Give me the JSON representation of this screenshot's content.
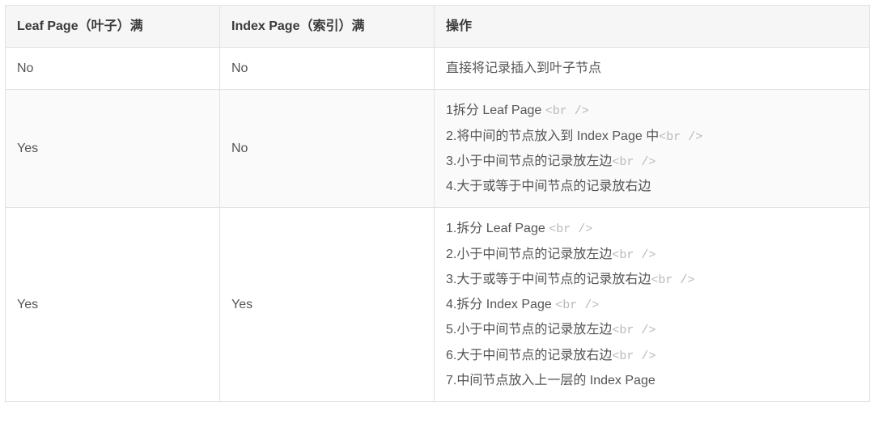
{
  "table": {
    "headers": {
      "leaf": "Leaf Page（叶子）满",
      "index": "Index Page（索引）满",
      "action": "操作"
    },
    "rows": [
      {
        "leaf": "No",
        "index": "No",
        "ops": [
          {
            "text": "直接将记录插入到叶子节点",
            "br": false
          }
        ]
      },
      {
        "leaf": "Yes",
        "index": "No",
        "ops": [
          {
            "text": "1拆分 Leaf Page ",
            "br": true
          },
          {
            "text": "2.将中间的节点放入到 Index Page 中",
            "br": true
          },
          {
            "text": "3.小于中间节点的记录放左边",
            "br": true
          },
          {
            "text": "4.大于或等于中间节点的记录放右边",
            "br": false
          }
        ]
      },
      {
        "leaf": "Yes",
        "index": "Yes",
        "ops": [
          {
            "text": "1.拆分 Leaf Page ",
            "br": true
          },
          {
            "text": "2.小于中间节点的记录放左边",
            "br": true
          },
          {
            "text": "3.大于或等于中间节点的记录放右边",
            "br": true
          },
          {
            "text": "4.拆分 Index Page ",
            "br": true
          },
          {
            "text": "5.小于中间节点的记录放左边",
            "br": true
          },
          {
            "text": "6.大于中间节点的记录放右边",
            "br": true
          },
          {
            "text": "7.中间节点放入上一层的 Index Page",
            "br": false
          }
        ]
      }
    ]
  },
  "brLiteral": "<br />"
}
